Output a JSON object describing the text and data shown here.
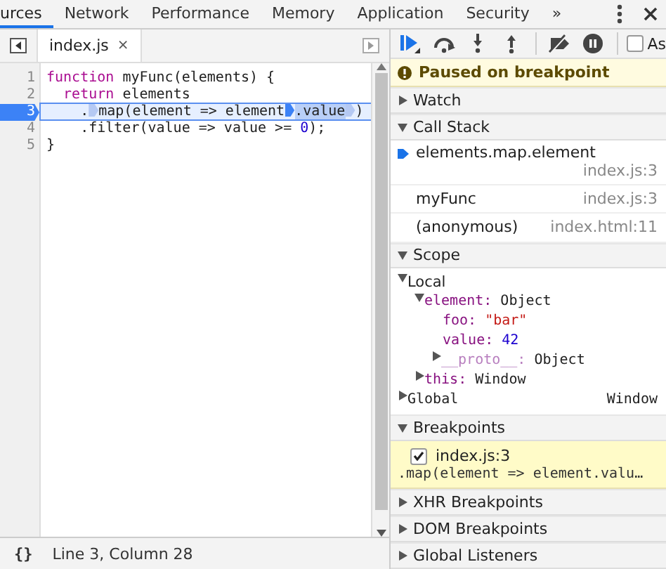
{
  "panel_tabs": [
    {
      "label": "urces",
      "selected": true
    },
    {
      "label": "Network",
      "selected": false
    },
    {
      "label": "Performance",
      "selected": false
    },
    {
      "label": "Memory",
      "selected": false
    },
    {
      "label": "Application",
      "selected": false
    },
    {
      "label": "Security",
      "selected": false
    },
    {
      "label": "»",
      "selected": false
    }
  ],
  "editor": {
    "file_tab": {
      "label": "index.js",
      "close": "×"
    },
    "lines": [
      {
        "number": "1",
        "current": false,
        "tokens": [
          {
            "kind": "keyword",
            "text": "function"
          },
          {
            "kind": "plain",
            "text": " myFunc(elements) {"
          }
        ]
      },
      {
        "number": "2",
        "current": false,
        "tokens": [
          {
            "kind": "keyword",
            "text": "  return"
          },
          {
            "kind": "plain",
            "text": " elements"
          }
        ]
      },
      {
        "number": "3",
        "current": true,
        "tokens": [
          {
            "kind": "plain",
            "text": "    ."
          },
          {
            "kind": "marker",
            "active": false
          },
          {
            "kind": "plain",
            "text": "map(element => element"
          },
          {
            "kind": "marker",
            "active": true
          },
          {
            "kind": "highlight",
            "text": ".value"
          },
          {
            "kind": "marker",
            "active": false
          },
          {
            "kind": "plain",
            "text": ")"
          }
        ]
      },
      {
        "number": "4",
        "current": false,
        "tokens": [
          {
            "kind": "plain",
            "text": "    .filter(value => value >= "
          },
          {
            "kind": "number",
            "text": "0"
          },
          {
            "kind": "plain",
            "text": ");"
          }
        ]
      },
      {
        "number": "5",
        "current": false,
        "tokens": [
          {
            "kind": "plain",
            "text": "}"
          }
        ]
      }
    ],
    "status": {
      "format_button": "{}",
      "position": "Line 3, Column 28"
    }
  },
  "debugger": {
    "async_label": "As",
    "async_checked": false,
    "paused_message": "Paused on breakpoint",
    "sections": [
      {
        "kind": "watch",
        "title": "Watch",
        "expanded": false
      },
      {
        "kind": "callstack",
        "title": "Call Stack",
        "expanded": true,
        "frames": [
          {
            "name": "elements.map.element",
            "location": "index.js:3",
            "selected": true
          },
          {
            "name": "myFunc",
            "location": "index.js:3",
            "selected": false
          },
          {
            "name": "(anonymous)",
            "location": "index.html:11",
            "selected": false
          }
        ]
      },
      {
        "kind": "scope",
        "title": "Scope",
        "expanded": true,
        "scopes": [
          {
            "name": "Local",
            "expanded": true,
            "children": [
              {
                "name": "element:",
                "value": "Object",
                "kind": "object",
                "expanded": true,
                "children": [
                  {
                    "name": "foo:",
                    "value": "\"bar\"",
                    "kind": "string"
                  },
                  {
                    "name": "value:",
                    "value": "42",
                    "kind": "number"
                  },
                  {
                    "name": "__proto__:",
                    "value": "Object",
                    "kind": "object",
                    "expanded": false,
                    "dim": true
                  }
                ]
              },
              {
                "name": "this:",
                "value": "Window",
                "kind": "object",
                "expanded": false
              }
            ]
          },
          {
            "name": "Global",
            "value": "Window",
            "expanded": false
          }
        ]
      },
      {
        "kind": "breakpoints",
        "title": "Breakpoints",
        "expanded": true,
        "items": [
          {
            "location": "index.js:3",
            "code": ".map(element => element.valu…",
            "checked": true
          }
        ]
      },
      {
        "kind": "plain",
        "title": "XHR Breakpoints",
        "expanded": false
      },
      {
        "kind": "plain",
        "title": "DOM Breakpoints",
        "expanded": false
      },
      {
        "kind": "plain",
        "title": "Global Listeners",
        "expanded": false
      }
    ]
  }
}
